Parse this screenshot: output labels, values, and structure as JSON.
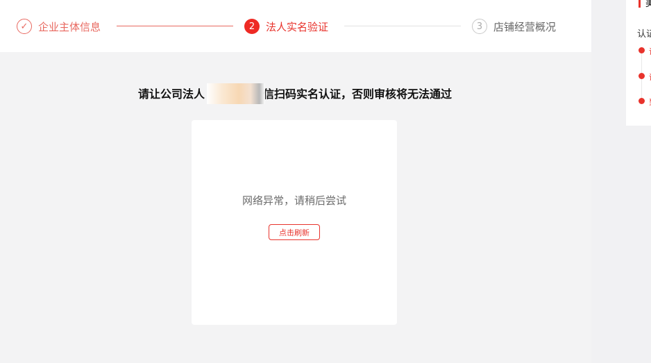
{
  "stepper": {
    "steps": [
      {
        "label": "企业主体信息",
        "marker": "✓",
        "state": "done"
      },
      {
        "label": "法人实名验证",
        "marker": "2",
        "state": "active"
      },
      {
        "label": "店铺经营概况",
        "marker": "3",
        "state": "pending"
      }
    ]
  },
  "main": {
    "instruction": "请让公司法人",
    "instruction_tail": "信扫码实名认证，否则审核将无法通过",
    "qr_card": {
      "error_text": "网络异常，请稍后尝试",
      "refresh_label": "点击刷新"
    }
  },
  "side_panel": {
    "title_fragment": "美",
    "label_fragment": "认证",
    "items": [
      "请",
      "请",
      "到"
    ]
  },
  "colors": {
    "accent": "#ee2a24",
    "done": "#e8685f",
    "background": "#f3f3f4"
  }
}
